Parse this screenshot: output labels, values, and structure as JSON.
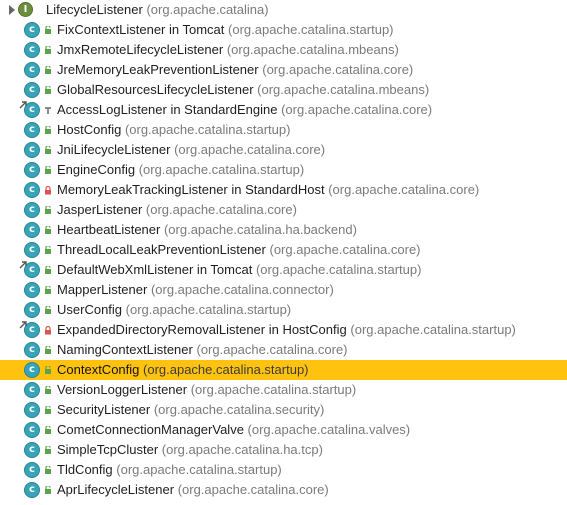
{
  "root": {
    "name": "LifecycleListener",
    "package": "(org.apache.catalina)",
    "icon": "interface-icon"
  },
  "items": [
    {
      "name": "FixContextListener in Tomcat",
      "package": "(org.apache.catalina.startup)",
      "visibility": "public",
      "extends_mark": false
    },
    {
      "name": "JmxRemoteLifecycleListener",
      "package": "(org.apache.catalina.mbeans)",
      "visibility": "public",
      "extends_mark": false
    },
    {
      "name": "JreMemoryLeakPreventionListener",
      "package": "(org.apache.catalina.core)",
      "visibility": "public",
      "extends_mark": false
    },
    {
      "name": "GlobalResourcesLifecycleListener",
      "package": "(org.apache.catalina.mbeans)",
      "visibility": "public",
      "extends_mark": false
    },
    {
      "name": "AccessLogListener in StandardEngine",
      "package": "(org.apache.catalina.core)",
      "visibility": "package",
      "extends_mark": true
    },
    {
      "name": "HostConfig",
      "package": "(org.apache.catalina.startup)",
      "visibility": "public",
      "extends_mark": false
    },
    {
      "name": "JniLifecycleListener",
      "package": "(org.apache.catalina.core)",
      "visibility": "public",
      "extends_mark": false
    },
    {
      "name": "EngineConfig",
      "package": "(org.apache.catalina.startup)",
      "visibility": "public",
      "extends_mark": false
    },
    {
      "name": "MemoryLeakTrackingListener in StandardHost",
      "package": "(org.apache.catalina.core)",
      "visibility": "private",
      "extends_mark": false
    },
    {
      "name": "JasperListener",
      "package": "(org.apache.catalina.core)",
      "visibility": "public",
      "extends_mark": false
    },
    {
      "name": "HeartbeatListener",
      "package": "(org.apache.catalina.ha.backend)",
      "visibility": "public",
      "extends_mark": false
    },
    {
      "name": "ThreadLocalLeakPreventionListener",
      "package": "(org.apache.catalina.core)",
      "visibility": "public",
      "extends_mark": false
    },
    {
      "name": "DefaultWebXmlListener in Tomcat",
      "package": "(org.apache.catalina.startup)",
      "visibility": "public",
      "extends_mark": true
    },
    {
      "name": "MapperListener",
      "package": "(org.apache.catalina.connector)",
      "visibility": "public",
      "extends_mark": false
    },
    {
      "name": "UserConfig",
      "package": "(org.apache.catalina.startup)",
      "visibility": "public",
      "extends_mark": false
    },
    {
      "name": "ExpandedDirectoryRemovalListener in HostConfig",
      "package": "(org.apache.catalina.startup)",
      "visibility": "private",
      "extends_mark": true
    },
    {
      "name": "NamingContextListener",
      "package": "(org.apache.catalina.core)",
      "visibility": "public",
      "extends_mark": false
    },
    {
      "name": "ContextConfig",
      "package": "(org.apache.catalina.startup)",
      "visibility": "public",
      "extends_mark": false,
      "selected": true
    },
    {
      "name": "VersionLoggerListener",
      "package": "(org.apache.catalina.startup)",
      "visibility": "public",
      "extends_mark": false
    },
    {
      "name": "SecurityListener",
      "package": "(org.apache.catalina.security)",
      "visibility": "public",
      "extends_mark": false
    },
    {
      "name": "CometConnectionManagerValve",
      "package": "(org.apache.catalina.valves)",
      "visibility": "public",
      "extends_mark": false
    },
    {
      "name": "SimpleTcpCluster",
      "package": "(org.apache.catalina.ha.tcp)",
      "visibility": "public",
      "extends_mark": false
    },
    {
      "name": "TldConfig",
      "package": "(org.apache.catalina.startup)",
      "visibility": "public",
      "extends_mark": false
    },
    {
      "name": "AprLifecycleListener",
      "package": "(org.apache.catalina.core)",
      "visibility": "public",
      "extends_mark": false
    }
  ],
  "colors": {
    "selection": "#ffc30f",
    "class_icon": "#37a4b7",
    "public_icon": "#5aa34a",
    "private_icon": "#d9534f",
    "package_icon": "#8a8a8a",
    "package_text": "#7a7a7a"
  },
  "icons": {
    "class": "class-c-icon",
    "public": "public-visibility-icon",
    "private": "private-visibility-icon",
    "package": "package-visibility-icon"
  }
}
